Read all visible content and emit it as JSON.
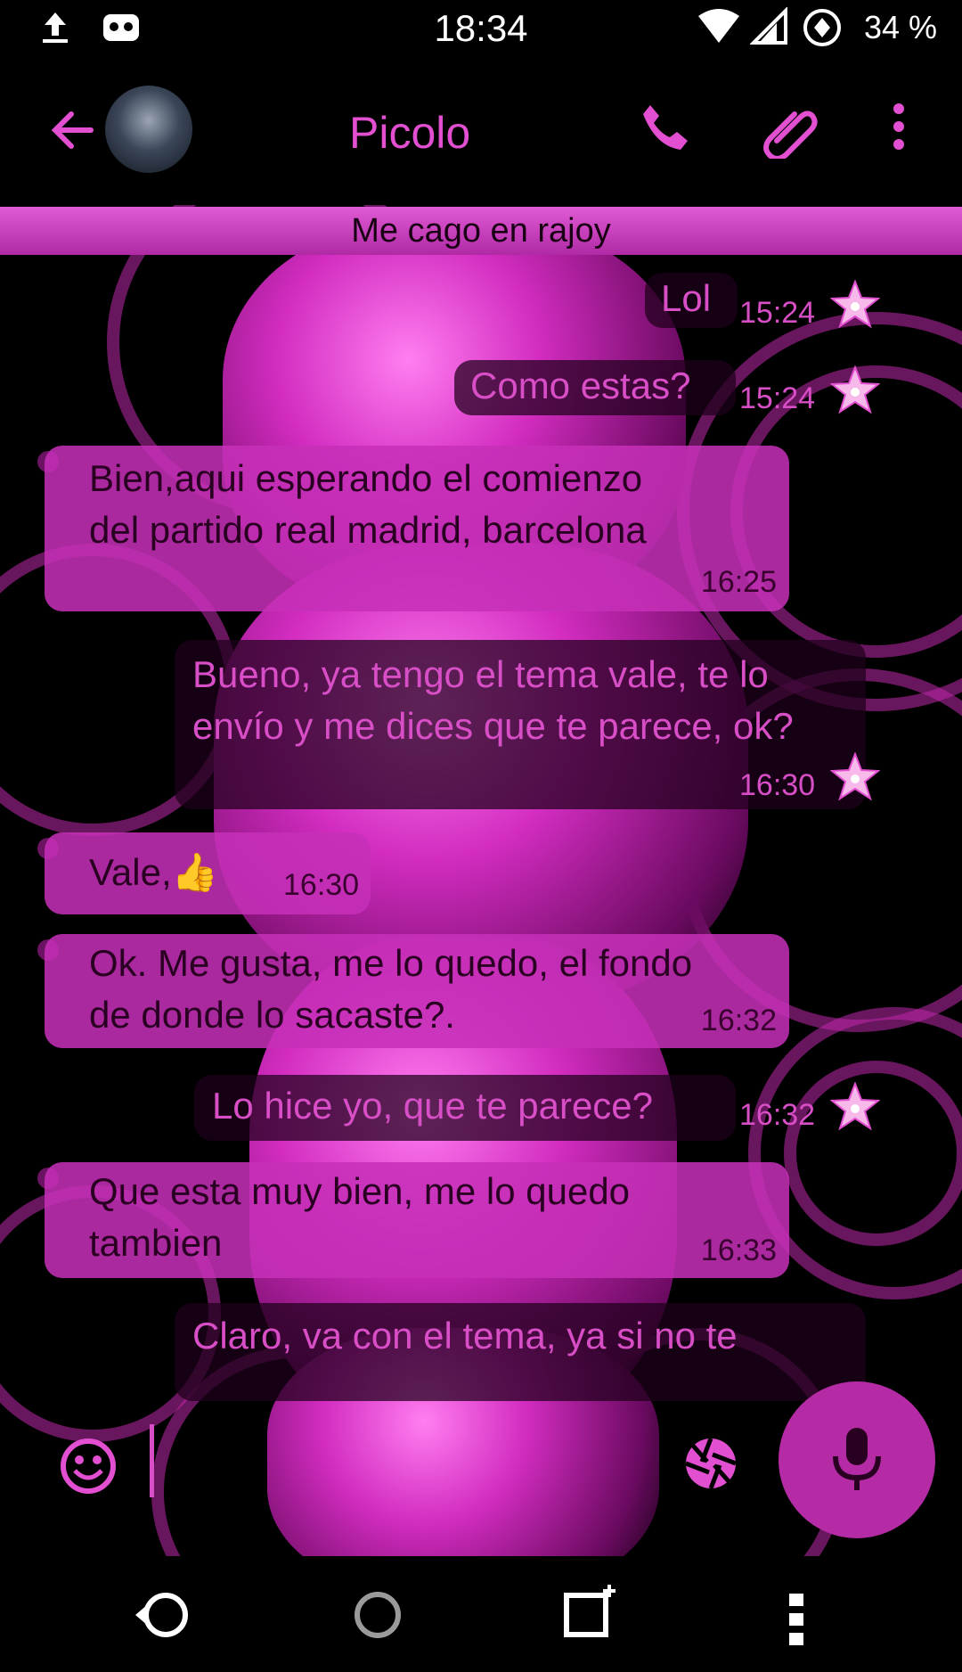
{
  "status_bar": {
    "time": "18:34",
    "battery": "34 %",
    "icons": [
      "upload-icon",
      "notification-app-icon",
      "wifi-icon",
      "signal-icon",
      "data-saver-icon"
    ]
  },
  "toolbar": {
    "back_icon": "arrow-left-icon",
    "contact_name": "Picolo",
    "actions": [
      "phone-icon",
      "attachment-icon",
      "overflow-menu-icon"
    ]
  },
  "topic": "Me cago en rajoy",
  "messages": [
    {
      "direction": "out",
      "text": "Lol",
      "time": "15:24"
    },
    {
      "direction": "out",
      "text": "Como estas?",
      "time": "15:24"
    },
    {
      "direction": "in",
      "line1": "Bien,aqui esperando el comienzo",
      "line2": "del partido real madrid, barcelona",
      "time": "16:25"
    },
    {
      "direction": "out",
      "line1": "Bueno, ya tengo el tema vale, te lo",
      "line2": "envío y me dices que te parece, ok?",
      "time": "16:30"
    },
    {
      "direction": "in",
      "text": "Vale,👍",
      "time": "16:30"
    },
    {
      "direction": "in",
      "line1": "Ok. Me gusta, me lo quedo, el fondo",
      "line2": "de donde lo sacaste?.",
      "time": "16:32"
    },
    {
      "direction": "out",
      "text": "Lo  hice  yo, que te parece?",
      "time": "16:32"
    },
    {
      "direction": "in",
      "line1": "Que esta muy bien, me lo quedo",
      "line2": "tambien",
      "time": "16:33"
    },
    {
      "direction": "out",
      "text": "Claro, va con el tema, ya si no te"
    }
  ],
  "input": {
    "emoji_icon": "emoji-smiley-icon",
    "camera_icon": "camera-shutter-icon",
    "mic_icon": "microphone-icon"
  },
  "nav": [
    "back-icon",
    "home-icon",
    "recents-icon",
    "menu-icon"
  ],
  "colors": {
    "accent": "#e24fd0",
    "bubble_in": "#c630b8",
    "bubble_out": "#1e001a",
    "fab": "#b52ba6"
  }
}
